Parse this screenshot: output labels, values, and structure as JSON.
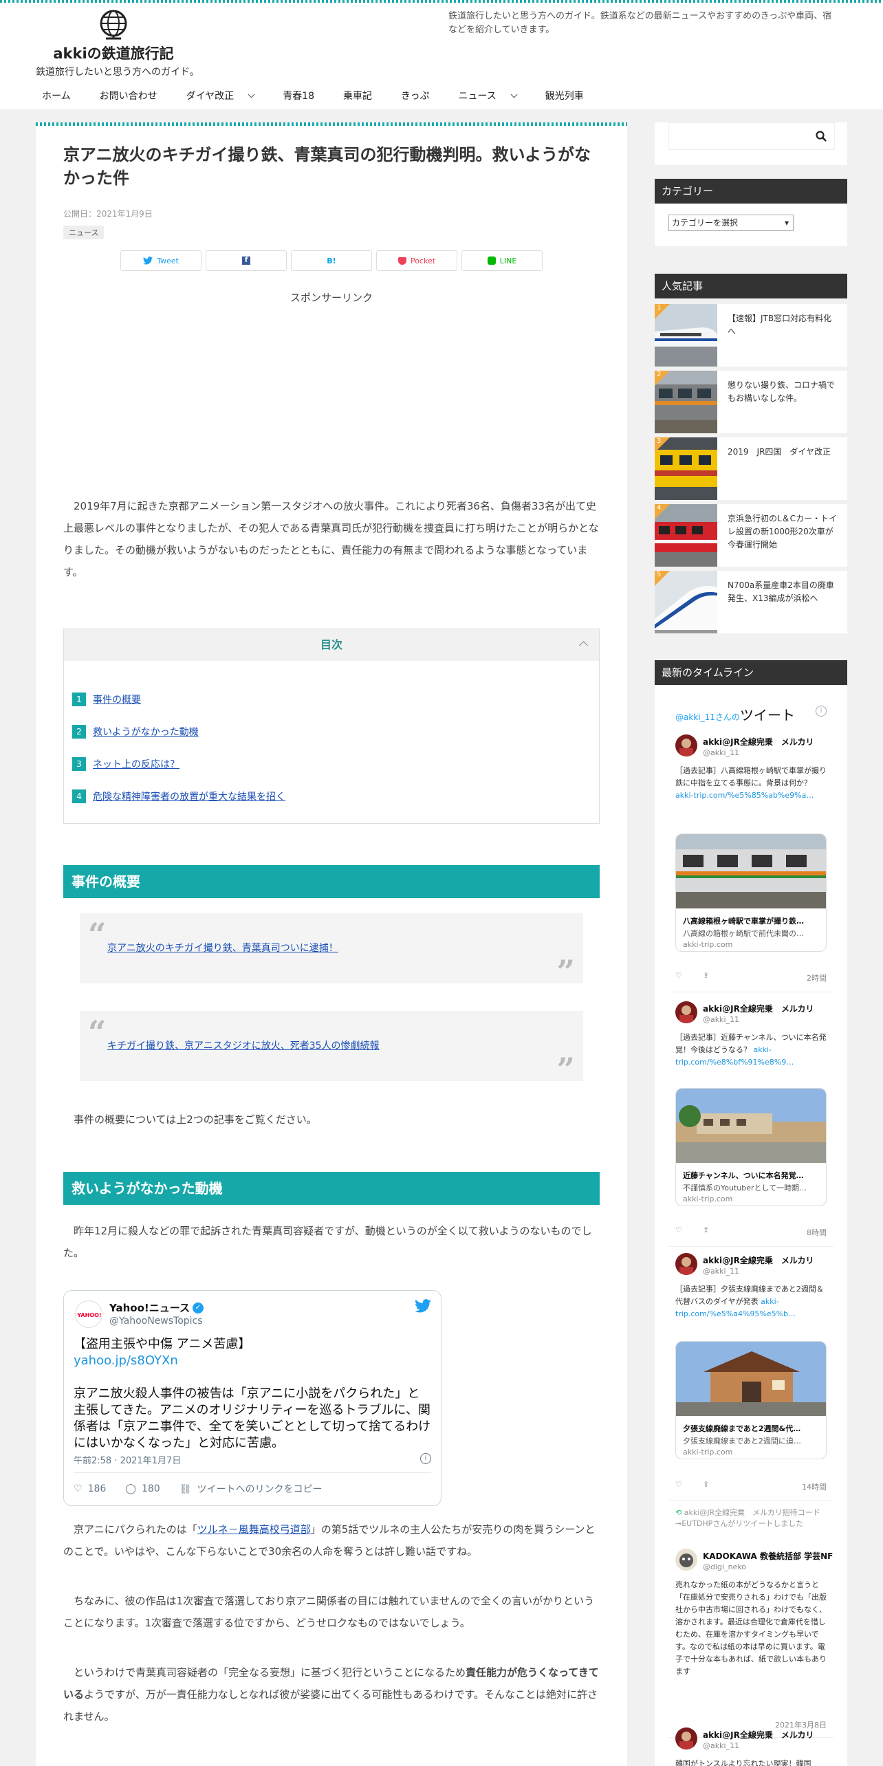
{
  "header": {
    "site_name": "akkiの鉄道旅行記",
    "tagline": "鉄道旅行したいと思う方へのガイド。",
    "description": "鉄道旅行したいと思う方へのガイド。鉄道系などの最新ニュースやおすすめのきっぷや車両、宿などを紹介していきます。"
  },
  "nav": [
    {
      "label": "ホーム",
      "dropdown": false
    },
    {
      "label": "お問い合わせ",
      "dropdown": false
    },
    {
      "label": "ダイヤ改正",
      "dropdown": true
    },
    {
      "label": "青春18",
      "dropdown": false
    },
    {
      "label": "乗車記",
      "dropdown": false
    },
    {
      "label": "きっぷ",
      "dropdown": false
    },
    {
      "label": "ニュース",
      "dropdown": true
    },
    {
      "label": "観光列車",
      "dropdown": false
    }
  ],
  "article": {
    "title": "京アニ放火のキチガイ撮り鉄、青葉真司の犯行動機判明。救いようがなかった件",
    "date": "公開日：2021年1月9日",
    "category": "ニュース",
    "sns": {
      "tweet": "Tweet",
      "facebook": "",
      "hatena": "B!",
      "pocket": "Pocket",
      "line": "LINE"
    },
    "sponsor": "スポンサーリンク",
    "intro": "2019年7月に起きた京都アニメーション第一スタジオへの放火事件。これにより死者36名、負傷者33名が出て史上最悪レベルの事件となりましたが、その犯人である青葉真司氏が犯行動機を捜査員に打ち明けたことが明らかとなりました。その動機が救いようがないものだったとともに、責任能力の有無まで問われるような事態となっています。",
    "toc": {
      "title": "目次",
      "items": [
        {
          "num": "1",
          "label": "事件の概要"
        },
        {
          "num": "2",
          "label": "救いようがなかった動機"
        },
        {
          "num": "3",
          "label": "ネット上の反応は？"
        },
        {
          "num": "4",
          "label": "危険な精神障害者の放置が重大な結果を招く"
        }
      ]
    },
    "h2_1": "事件の概要",
    "quote1": "京アニ放火のキチガイ撮り鉄、青葉真司ついに逮捕！",
    "quote2": "キチガイ撮り鉄、京アニスタジオに放火、死者35人の惨劇続報",
    "para_overview": "事件の概要については上2つの記事をご覧ください。",
    "h2_2": "救いようがなかった動機",
    "para_motive": "昨年12月に殺人などの罪で起訴された青葉真司容疑者ですが、動機というのが全く以て救いようのないものでした。",
    "tweet": {
      "name": "Yahoo!ニュース",
      "handle": "@YahooNewsTopics",
      "line1": "【盗用主張や中傷 アニメ苦慮】",
      "link": "yahoo.jp/s8OYXn",
      "text": "京アニ放火殺人事件の被告は「京アニに小説をパクられた」と主張してきた。アニメのオリジナリティーを巡るトラブルに、関係者は「京アニ事件で、全てを笑いごととして切って捨てるわけにはいかなくなった」と対応に苦慮。",
      "time": "午前2:58 · 2021年1月7日",
      "likes": "186",
      "replies": "180",
      "copy": "ツイートへのリンクをコピー"
    },
    "para3_pre": "京アニにパクられたのは「",
    "para3_link": "ツルネ－風舞高校弓道部",
    "para3_post": "」の第5話でツルネの主人公たちが安売りの肉を買うシーンとのことで。いやはや、こんな下らないことで30余名の人命を奪うとは許し難い話ですね。",
    "para4": "ちなみに、彼の作品は1次審査で落選しており京アニ関係者の目には触れていませんので全くの言いがかりということになります。1次審査で落選する位ですから、どうせロクなものではないでしょう。",
    "para5_pre": "というわけで青葉真司容疑者の「完全なる妄想」に基づく犯行ということになるため",
    "para5_bold": "責任能力が危うくなってきている",
    "para5_post": "ようですが、万が一責任能力なしとなれば彼が娑婆に出てくる可能性もあるわけです。そんなことは絶対に許されません。"
  },
  "sidebar": {
    "category_title": "カテゴリー",
    "category_select": "カテゴリーを選択",
    "popular_title": "人気記事",
    "popular": [
      {
        "rank": "1",
        "title": "【速報】JTB窓口対応有料化へ"
      },
      {
        "rank": "2",
        "title": "懲りない撮り鉄、コロナ禍でもお構いなしな件。"
      },
      {
        "rank": "3",
        "title": "2019　JR四国　ダイヤ改正"
      },
      {
        "rank": "4",
        "title": "京浜急行初のL＆Cカー・トイレ設置の新1000形20次車が今春運行開始"
      },
      {
        "rank": "5",
        "title": "N700a系量産車2本目の廃車発生、X13編成が浜松へ"
      }
    ],
    "timeline_title": "最新のタイムライン",
    "timeline_head_user": "@akki_11さんの",
    "timeline_head_word": "ツイート",
    "tweets": [
      {
        "name": "akki@JR全線完乗　メルカリ",
        "handle": "@akki_11",
        "text": "［過去記事］八高線箱根ヶ崎駅で車掌が撮り鉄に中指を立てる事態に。背景は何か？ ",
        "link": "akki-trip.com/%e5%85%ab%e9%a…",
        "card_title": "八高線箱根ヶ崎駅で車掌が撮り鉄…",
        "card_desc": "八高線の箱根ヶ崎駅で前代未聞の…",
        "card_url": "akki-trip.com",
        "time": "2時間"
      },
      {
        "name": "akki@JR全線完乗　メルカリ",
        "handle": "@akki_11",
        "text": "［過去記事］近藤チャンネル、ついに本名発覚！今後はどうなる？ ",
        "link": "akki-trip.com/%e8%bf%91%e8%9…",
        "card_title": "近藤チャンネル、ついに本名発覚…",
        "card_desc": "不謹慎系のYoutuberとして一時期…",
        "card_url": "akki-trip.com",
        "time": "8時間"
      },
      {
        "name": "akki@JR全線完乗　メルカリ",
        "handle": "@akki_11",
        "text": "［過去記事］夕張支線廃線まであと2週間＆代替バスのダイヤが発表 ",
        "link": "akki-trip.com/%e5%a4%95%e5%b…",
        "card_title": "夕張支線廃線まであと2週間&代…",
        "card_desc": "夕張支線廃線まであと2週間に迫…",
        "card_url": "akki-trip.com",
        "time": "14時間"
      }
    ],
    "retweet_label": "akki@JR全線完乗　メルカリ招待コード→EUTDHPさんがリツイートしました",
    "retweet": {
      "name": "KADOKAWA 教養統括部 学芸NF",
      "handle": "@digi_neko",
      "text": "売れなかった紙の本がどうなるかと言うと「在庫処分で安売りされる」わけでも「出版社から中古市場に回される」わけでもなく、溶かされます。最近は合理化で倉庫代を惜しむため、在庫を溶かすタイミングも早いです。なので私は紙の本は早めに買います。電子で十分な本もあれば、紙で欲しい本もあります",
      "time": "2021年3月8日"
    },
    "last_tweet": {
      "name": "akki@JR全線完乗　メルカリ",
      "handle": "@akki_11",
      "text": "韓国がトンスルより忘れたい現実！韓国"
    }
  },
  "colors": {
    "accent": "#16a8a8",
    "widget_dark": "#333333",
    "twitter": "#1da1f2"
  }
}
